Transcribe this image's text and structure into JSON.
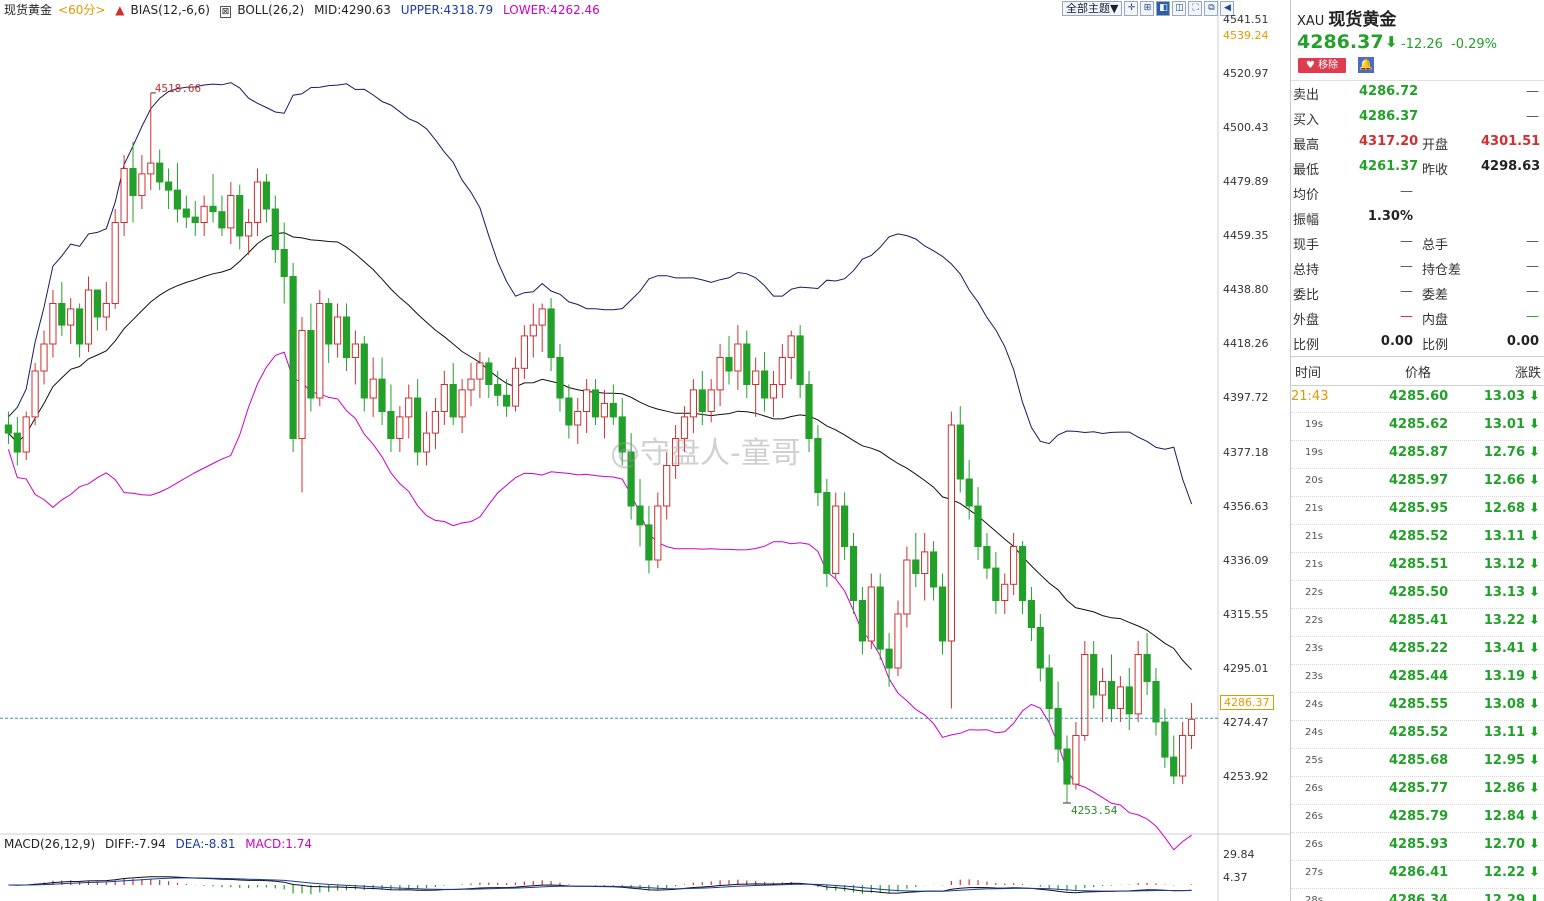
{
  "legend": {
    "instrument": "现货黄金",
    "period": "<60分>",
    "bias": "BIAS(12,-6,6)",
    "boll": "BOLL(26,2)",
    "mid": "MID:4290.63",
    "upper": "UPPER:4318.79",
    "lower": "LOWER:4262.46"
  },
  "toolbar": {
    "theme_label": "全部主题▼"
  },
  "price_axis": {
    "top_label": "4541.51",
    "high_label": "4539.24",
    "ticks": [
      "4520.97",
      "4500.43",
      "4479.89",
      "4459.35",
      "4438.80",
      "4418.26",
      "4397.72",
      "4377.18",
      "4356.63",
      "4336.09",
      "4315.55",
      "4295.01",
      "4274.47",
      "4253.92"
    ],
    "current_badge": "4286.37"
  },
  "annotations": {
    "max_label": "4518.66",
    "min_label": "4253.54"
  },
  "macd": {
    "title": "MACD(26,12,9)",
    "diff": "DIFF:-7.94",
    "dea": "DEA:-8.81",
    "macd": "MACD:1.74",
    "axis_top": "29.84",
    "axis_mid": "4.37"
  },
  "watermark": "@守盘人-童哥",
  "colors": {
    "up": "#d03030",
    "down": "#22a02a",
    "boll_lower": "#cc00cc",
    "boll_upper": "#1a1a66",
    "current": "#e09a00"
  },
  "quote": {
    "code": "XAU",
    "name": "现货黄金",
    "price": "4286.37",
    "change": "-12.26",
    "change_pct": "-0.29%",
    "remove_label": "移除",
    "rows": [
      {
        "l1": "卖出",
        "v1": "4286.72",
        "l2": "",
        "v2": "—"
      },
      {
        "l1": "买入",
        "v1": "4286.37",
        "l2": "",
        "v2": "—"
      },
      {
        "l1": "最高",
        "v1": "4317.20",
        "l2": "开盘",
        "v2": "4301.51"
      },
      {
        "l1": "最低",
        "v1": "4261.37",
        "l2": "昨收",
        "v2": "4298.63"
      },
      {
        "l1": "均价",
        "v1": "—",
        "l2": "",
        "v2": ""
      },
      {
        "l1": "振幅",
        "v1": "1.30%",
        "l2": "",
        "v2": ""
      },
      {
        "l1": "现手",
        "v1": "—",
        "l2": "总手",
        "v2": "—"
      },
      {
        "l1": "总持",
        "v1": "—",
        "l2": "持仓差",
        "v2": "—"
      },
      {
        "l1": "委比",
        "v1": "—",
        "l2": "委差",
        "v2": "—"
      },
      {
        "l1": "外盘",
        "v1": "—",
        "l2": "内盘",
        "v2": "—"
      },
      {
        "l1": "比例",
        "v1": "0.00",
        "l2": "比例",
        "v2": "0.00"
      }
    ]
  },
  "ticks_table": {
    "headers": {
      "time": "时间",
      "price": "价格",
      "change": "涨跌"
    },
    "rows": [
      {
        "time": "21:43",
        "price": "4285.60",
        "change": "13.03"
      },
      {
        "time": "19s",
        "price": "4285.62",
        "change": "13.01"
      },
      {
        "time": "19s",
        "price": "4285.87",
        "change": "12.76"
      },
      {
        "time": "20s",
        "price": "4285.97",
        "change": "12.66"
      },
      {
        "time": "21s",
        "price": "4285.95",
        "change": "12.68"
      },
      {
        "time": "21s",
        "price": "4285.52",
        "change": "13.11"
      },
      {
        "time": "21s",
        "price": "4285.51",
        "change": "13.12"
      },
      {
        "time": "22s",
        "price": "4285.50",
        "change": "13.13"
      },
      {
        "time": "22s",
        "price": "4285.41",
        "change": "13.22"
      },
      {
        "time": "23s",
        "price": "4285.22",
        "change": "13.41"
      },
      {
        "time": "23s",
        "price": "4285.44",
        "change": "13.19"
      },
      {
        "time": "24s",
        "price": "4285.55",
        "change": "13.08"
      },
      {
        "time": "24s",
        "price": "4285.52",
        "change": "13.11"
      },
      {
        "time": "25s",
        "price": "4285.68",
        "change": "12.95"
      },
      {
        "time": "26s",
        "price": "4285.77",
        "change": "12.86"
      },
      {
        "time": "26s",
        "price": "4285.79",
        "change": "12.84"
      },
      {
        "time": "26s",
        "price": "4285.93",
        "change": "12.70"
      },
      {
        "time": "27s",
        "price": "4286.41",
        "change": "12.22"
      },
      {
        "time": "28s",
        "price": "4286.34",
        "change": "12.29"
      }
    ]
  },
  "chart_data": {
    "type": "candlestick",
    "ylim": [
      4245,
      4545
    ],
    "reference_price": 4286.37,
    "candles": [
      [
        4395,
        4400,
        4388,
        4392
      ],
      [
        4392,
        4398,
        4380,
        4385
      ],
      [
        4385,
        4400,
        4382,
        4398
      ],
      [
        4398,
        4418,
        4395,
        4415
      ],
      [
        4415,
        4430,
        4410,
        4425
      ],
      [
        4425,
        4445,
        4420,
        4440
      ],
      [
        4440,
        4448,
        4428,
        4432
      ],
      [
        4432,
        4442,
        4425,
        4438
      ],
      [
        4438,
        4440,
        4420,
        4425
      ],
      [
        4425,
        4450,
        4422,
        4445
      ],
      [
        4445,
        4440,
        4430,
        4435
      ],
      [
        4435,
        4448,
        4430,
        4440
      ],
      [
        4440,
        4475,
        4438,
        4470
      ],
      [
        4470,
        4495,
        4465,
        4490
      ],
      [
        4490,
        4500,
        4470,
        4480
      ],
      [
        4480,
        4495,
        4475,
        4488
      ],
      [
        4488,
        4518,
        4482,
        4492
      ],
      [
        4492,
        4497,
        4482,
        4485
      ],
      [
        4485,
        4490,
        4475,
        4482
      ],
      [
        4482,
        4492,
        4470,
        4475
      ],
      [
        4475,
        4480,
        4468,
        4472
      ],
      [
        4472,
        4478,
        4465,
        4470
      ],
      [
        4470,
        4480,
        4465,
        4476
      ],
      [
        4476,
        4488,
        4470,
        4474
      ],
      [
        4474,
        4480,
        4465,
        4468
      ],
      [
        4468,
        4485,
        4462,
        4480
      ],
      [
        4480,
        4484,
        4460,
        4465
      ],
      [
        4465,
        4475,
        4458,
        4470
      ],
      [
        4470,
        4490,
        4465,
        4485
      ],
      [
        4485,
        4488,
        4470,
        4475
      ],
      [
        4475,
        4480,
        4455,
        4460
      ],
      [
        4460,
        4470,
        4440,
        4450
      ],
      [
        4450,
        4455,
        4385,
        4390
      ],
      [
        4390,
        4435,
        4370,
        4430
      ],
      [
        4430,
        4440,
        4400,
        4405
      ],
      [
        4405,
        4445,
        4402,
        4440
      ],
      [
        4440,
        4442,
        4418,
        4425
      ],
      [
        4425,
        4440,
        4420,
        4435
      ],
      [
        4435,
        4440,
        4415,
        4420
      ],
      [
        4420,
        4430,
        4410,
        4425
      ],
      [
        4425,
        4428,
        4400,
        4405
      ],
      [
        4405,
        4420,
        4398,
        4412
      ],
      [
        4412,
        4420,
        4395,
        4400
      ],
      [
        4400,
        4410,
        4385,
        4390
      ],
      [
        4390,
        4402,
        4385,
        4398
      ],
      [
        4398,
        4410,
        4390,
        4405
      ],
      [
        4405,
        4412,
        4380,
        4385
      ],
      [
        4385,
        4400,
        4380,
        4392
      ],
      [
        4392,
        4405,
        4386,
        4400
      ],
      [
        4400,
        4415,
        4395,
        4410
      ],
      [
        4410,
        4418,
        4395,
        4398
      ],
      [
        4398,
        4412,
        4392,
        4408
      ],
      [
        4408,
        4418,
        4402,
        4412
      ],
      [
        4412,
        4422,
        4405,
        4418
      ],
      [
        4418,
        4420,
        4405,
        4410
      ],
      [
        4410,
        4415,
        4402,
        4406
      ],
      [
        4406,
        4412,
        4398,
        4402
      ],
      [
        4402,
        4420,
        4400,
        4416
      ],
      [
        4416,
        4432,
        4412,
        4428
      ],
      [
        4428,
        4440,
        4420,
        4432
      ],
      [
        4432,
        4440,
        4422,
        4438
      ],
      [
        4438,
        4442,
        4415,
        4420
      ],
      [
        4420,
        4425,
        4400,
        4405
      ],
      [
        4405,
        4410,
        4390,
        4395
      ],
      [
        4395,
        4405,
        4388,
        4400
      ],
      [
        4400,
        4412,
        4392,
        4408
      ],
      [
        4408,
        4412,
        4395,
        4398
      ],
      [
        4398,
        4408,
        4390,
        4403
      ],
      [
        4403,
        4410,
        4395,
        4398
      ],
      [
        4398,
        4405,
        4380,
        4385
      ],
      [
        4385,
        4392,
        4360,
        4365
      ],
      [
        4365,
        4375,
        4350,
        4358
      ],
      [
        4358,
        4365,
        4340,
        4345
      ],
      [
        4345,
        4370,
        4342,
        4365
      ],
      [
        4365,
        4385,
        4360,
        4380
      ],
      [
        4380,
        4395,
        4375,
        4390
      ],
      [
        4390,
        4402,
        4385,
        4398
      ],
      [
        4398,
        4412,
        4392,
        4408
      ],
      [
        4408,
        4415,
        4395,
        4400
      ],
      [
        4400,
        4412,
        4396,
        4408
      ],
      [
        4408,
        4425,
        4402,
        4420
      ],
      [
        4420,
        4428,
        4410,
        4415
      ],
      [
        4415,
        4432,
        4408,
        4425
      ],
      [
        4425,
        4430,
        4405,
        4410
      ],
      [
        4410,
        4420,
        4398,
        4415
      ],
      [
        4415,
        4422,
        4400,
        4405
      ],
      [
        4405,
        4415,
        4398,
        4410
      ],
      [
        4410,
        4425,
        4405,
        4420
      ],
      [
        4420,
        4430,
        4412,
        4428
      ],
      [
        4428,
        4432,
        4405,
        4410
      ],
      [
        4410,
        4415,
        4385,
        4390
      ],
      [
        4390,
        4395,
        4365,
        4370
      ],
      [
        4370,
        4375,
        4335,
        4340
      ],
      [
        4340,
        4370,
        4338,
        4365
      ],
      [
        4365,
        4370,
        4345,
        4350
      ],
      [
        4350,
        4355,
        4325,
        4330
      ],
      [
        4330,
        4335,
        4310,
        4315
      ],
      [
        4315,
        4340,
        4312,
        4335
      ],
      [
        4335,
        4340,
        4308,
        4312
      ],
      [
        4312,
        4318,
        4298,
        4305
      ],
      [
        4305,
        4330,
        4302,
        4325
      ],
      [
        4325,
        4350,
        4320,
        4345
      ],
      [
        4345,
        4355,
        4335,
        4340
      ],
      [
        4340,
        4355,
        4330,
        4348
      ],
      [
        4348,
        4352,
        4330,
        4335
      ],
      [
        4335,
        4340,
        4310,
        4315
      ],
      [
        4315,
        4400,
        4290,
        4395
      ],
      [
        4395,
        4402,
        4370,
        4375
      ],
      [
        4375,
        4382,
        4360,
        4365
      ],
      [
        4365,
        4372,
        4345,
        4350
      ],
      [
        4350,
        4355,
        4338,
        4342
      ],
      [
        4342,
        4348,
        4325,
        4330
      ],
      [
        4330,
        4340,
        4325,
        4336
      ],
      [
        4336,
        4355,
        4332,
        4350
      ],
      [
        4350,
        4352,
        4325,
        4330
      ],
      [
        4330,
        4335,
        4315,
        4320
      ],
      [
        4320,
        4325,
        4300,
        4305
      ],
      [
        4305,
        4310,
        4285,
        4290
      ],
      [
        4290,
        4300,
        4270,
        4275
      ],
      [
        4275,
        4280,
        4255,
        4262
      ],
      [
        4262,
        4285,
        4260,
        4280
      ],
      [
        4280,
        4315,
        4278,
        4310
      ],
      [
        4310,
        4315,
        4290,
        4295
      ],
      [
        4295,
        4305,
        4285,
        4300
      ],
      [
        4300,
        4310,
        4285,
        4290
      ],
      [
        4290,
        4302,
        4285,
        4298
      ],
      [
        4298,
        4305,
        4282,
        4288
      ],
      [
        4288,
        4315,
        4285,
        4310
      ],
      [
        4310,
        4318,
        4295,
        4300
      ],
      [
        4300,
        4305,
        4280,
        4285
      ],
      [
        4285,
        4290,
        4268,
        4272
      ],
      [
        4272,
        4280,
        4262,
        4265
      ],
      [
        4265,
        4285,
        4262,
        4280
      ],
      [
        4280,
        4292,
        4275,
        4286
      ]
    ]
  }
}
